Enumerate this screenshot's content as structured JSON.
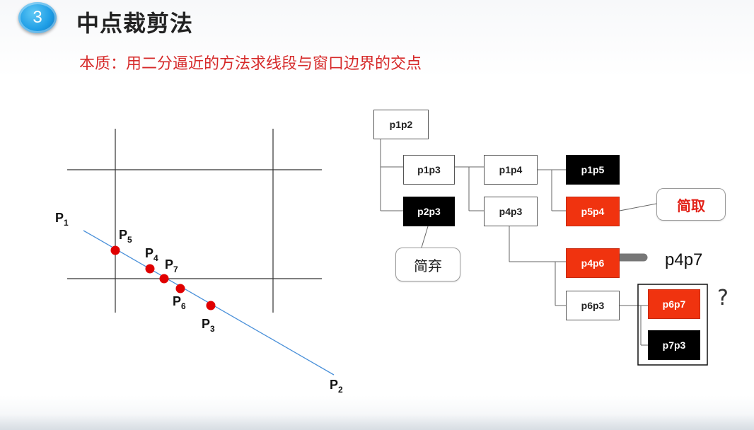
{
  "header": {
    "number": "3",
    "title": "中点裁剪法",
    "subtitle": "本质：用二分逼近的方法求线段与窗口边界的交点"
  },
  "points": {
    "p1": {
      "letter": "P",
      "sub": "1"
    },
    "p2": {
      "letter": "P",
      "sub": "2"
    },
    "p3": {
      "letter": "P",
      "sub": "3"
    },
    "p4": {
      "letter": "P",
      "sub": "4"
    },
    "p5": {
      "letter": "P",
      "sub": "5"
    },
    "p6": {
      "letter": "P",
      "sub": "6"
    },
    "p7": {
      "letter": "P",
      "sub": "7"
    }
  },
  "tree": {
    "p1p2": "p1p2",
    "p1p3": "p1p3",
    "p2p3": "p2p3",
    "p1p4": "p1p4",
    "p4p3": "p4p3",
    "p1p5": "p1p5",
    "p5p4": "p5p4",
    "p4p6": "p4p6",
    "p6p3": "p6p3",
    "p6p7": "p6p7",
    "p7p3": "p7p3"
  },
  "callouts": {
    "take": "简取",
    "discard": "简弃"
  },
  "annotations": {
    "p4p7": "p4p7",
    "question": "?"
  },
  "colors": {
    "accent_red": "#f0330f",
    "subtitle_red": "#d62a2a",
    "dark_node": "#000000",
    "badge_blue": "#1f9ee6",
    "segment_line": "#4a90d9",
    "point_red": "#e00000"
  }
}
